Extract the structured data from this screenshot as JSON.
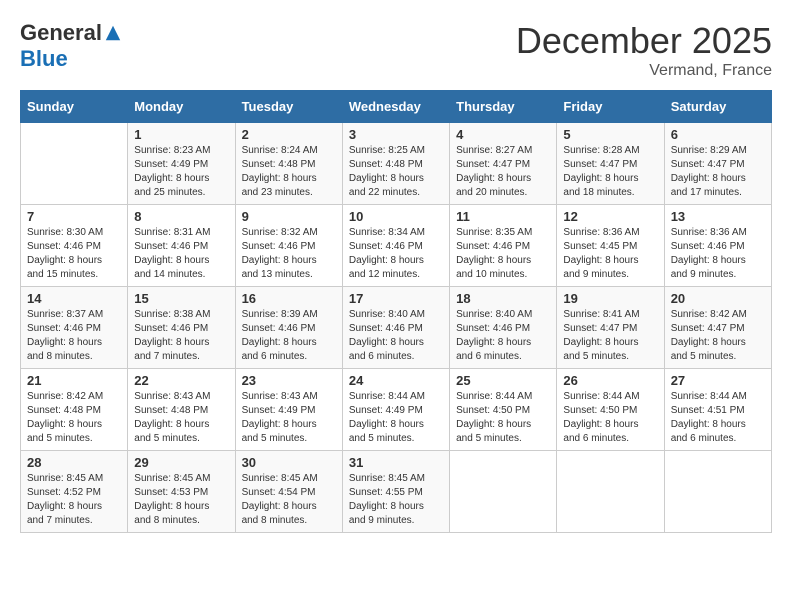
{
  "logo": {
    "general": "General",
    "blue": "Blue"
  },
  "title": "December 2025",
  "subtitle": "Vermand, France",
  "days_of_week": [
    "Sunday",
    "Monday",
    "Tuesday",
    "Wednesday",
    "Thursday",
    "Friday",
    "Saturday"
  ],
  "weeks": [
    [
      {
        "day": "",
        "sunrise": "",
        "sunset": "",
        "daylight": ""
      },
      {
        "day": "1",
        "sunrise": "Sunrise: 8:23 AM",
        "sunset": "Sunset: 4:49 PM",
        "daylight": "Daylight: 8 hours and 25 minutes."
      },
      {
        "day": "2",
        "sunrise": "Sunrise: 8:24 AM",
        "sunset": "Sunset: 4:48 PM",
        "daylight": "Daylight: 8 hours and 23 minutes."
      },
      {
        "day": "3",
        "sunrise": "Sunrise: 8:25 AM",
        "sunset": "Sunset: 4:48 PM",
        "daylight": "Daylight: 8 hours and 22 minutes."
      },
      {
        "day": "4",
        "sunrise": "Sunrise: 8:27 AM",
        "sunset": "Sunset: 4:47 PM",
        "daylight": "Daylight: 8 hours and 20 minutes."
      },
      {
        "day": "5",
        "sunrise": "Sunrise: 8:28 AM",
        "sunset": "Sunset: 4:47 PM",
        "daylight": "Daylight: 8 hours and 18 minutes."
      },
      {
        "day": "6",
        "sunrise": "Sunrise: 8:29 AM",
        "sunset": "Sunset: 4:47 PM",
        "daylight": "Daylight: 8 hours and 17 minutes."
      }
    ],
    [
      {
        "day": "7",
        "sunrise": "Sunrise: 8:30 AM",
        "sunset": "Sunset: 4:46 PM",
        "daylight": "Daylight: 8 hours and 15 minutes."
      },
      {
        "day": "8",
        "sunrise": "Sunrise: 8:31 AM",
        "sunset": "Sunset: 4:46 PM",
        "daylight": "Daylight: 8 hours and 14 minutes."
      },
      {
        "day": "9",
        "sunrise": "Sunrise: 8:32 AM",
        "sunset": "Sunset: 4:46 PM",
        "daylight": "Daylight: 8 hours and 13 minutes."
      },
      {
        "day": "10",
        "sunrise": "Sunrise: 8:34 AM",
        "sunset": "Sunset: 4:46 PM",
        "daylight": "Daylight: 8 hours and 12 minutes."
      },
      {
        "day": "11",
        "sunrise": "Sunrise: 8:35 AM",
        "sunset": "Sunset: 4:46 PM",
        "daylight": "Daylight: 8 hours and 10 minutes."
      },
      {
        "day": "12",
        "sunrise": "Sunrise: 8:36 AM",
        "sunset": "Sunset: 4:45 PM",
        "daylight": "Daylight: 8 hours and 9 minutes."
      },
      {
        "day": "13",
        "sunrise": "Sunrise: 8:36 AM",
        "sunset": "Sunset: 4:46 PM",
        "daylight": "Daylight: 8 hours and 9 minutes."
      }
    ],
    [
      {
        "day": "14",
        "sunrise": "Sunrise: 8:37 AM",
        "sunset": "Sunset: 4:46 PM",
        "daylight": "Daylight: 8 hours and 8 minutes."
      },
      {
        "day": "15",
        "sunrise": "Sunrise: 8:38 AM",
        "sunset": "Sunset: 4:46 PM",
        "daylight": "Daylight: 8 hours and 7 minutes."
      },
      {
        "day": "16",
        "sunrise": "Sunrise: 8:39 AM",
        "sunset": "Sunset: 4:46 PM",
        "daylight": "Daylight: 8 hours and 6 minutes."
      },
      {
        "day": "17",
        "sunrise": "Sunrise: 8:40 AM",
        "sunset": "Sunset: 4:46 PM",
        "daylight": "Daylight: 8 hours and 6 minutes."
      },
      {
        "day": "18",
        "sunrise": "Sunrise: 8:40 AM",
        "sunset": "Sunset: 4:46 PM",
        "daylight": "Daylight: 8 hours and 6 minutes."
      },
      {
        "day": "19",
        "sunrise": "Sunrise: 8:41 AM",
        "sunset": "Sunset: 4:47 PM",
        "daylight": "Daylight: 8 hours and 5 minutes."
      },
      {
        "day": "20",
        "sunrise": "Sunrise: 8:42 AM",
        "sunset": "Sunset: 4:47 PM",
        "daylight": "Daylight: 8 hours and 5 minutes."
      }
    ],
    [
      {
        "day": "21",
        "sunrise": "Sunrise: 8:42 AM",
        "sunset": "Sunset: 4:48 PM",
        "daylight": "Daylight: 8 hours and 5 minutes."
      },
      {
        "day": "22",
        "sunrise": "Sunrise: 8:43 AM",
        "sunset": "Sunset: 4:48 PM",
        "daylight": "Daylight: 8 hours and 5 minutes."
      },
      {
        "day": "23",
        "sunrise": "Sunrise: 8:43 AM",
        "sunset": "Sunset: 4:49 PM",
        "daylight": "Daylight: 8 hours and 5 minutes."
      },
      {
        "day": "24",
        "sunrise": "Sunrise: 8:44 AM",
        "sunset": "Sunset: 4:49 PM",
        "daylight": "Daylight: 8 hours and 5 minutes."
      },
      {
        "day": "25",
        "sunrise": "Sunrise: 8:44 AM",
        "sunset": "Sunset: 4:50 PM",
        "daylight": "Daylight: 8 hours and 5 minutes."
      },
      {
        "day": "26",
        "sunrise": "Sunrise: 8:44 AM",
        "sunset": "Sunset: 4:50 PM",
        "daylight": "Daylight: 8 hours and 6 minutes."
      },
      {
        "day": "27",
        "sunrise": "Sunrise: 8:44 AM",
        "sunset": "Sunset: 4:51 PM",
        "daylight": "Daylight: 8 hours and 6 minutes."
      }
    ],
    [
      {
        "day": "28",
        "sunrise": "Sunrise: 8:45 AM",
        "sunset": "Sunset: 4:52 PM",
        "daylight": "Daylight: 8 hours and 7 minutes."
      },
      {
        "day": "29",
        "sunrise": "Sunrise: 8:45 AM",
        "sunset": "Sunset: 4:53 PM",
        "daylight": "Daylight: 8 hours and 8 minutes."
      },
      {
        "day": "30",
        "sunrise": "Sunrise: 8:45 AM",
        "sunset": "Sunset: 4:54 PM",
        "daylight": "Daylight: 8 hours and 8 minutes."
      },
      {
        "day": "31",
        "sunrise": "Sunrise: 8:45 AM",
        "sunset": "Sunset: 4:55 PM",
        "daylight": "Daylight: 8 hours and 9 minutes."
      },
      {
        "day": "",
        "sunrise": "",
        "sunset": "",
        "daylight": ""
      },
      {
        "day": "",
        "sunrise": "",
        "sunset": "",
        "daylight": ""
      },
      {
        "day": "",
        "sunrise": "",
        "sunset": "",
        "daylight": ""
      }
    ]
  ]
}
